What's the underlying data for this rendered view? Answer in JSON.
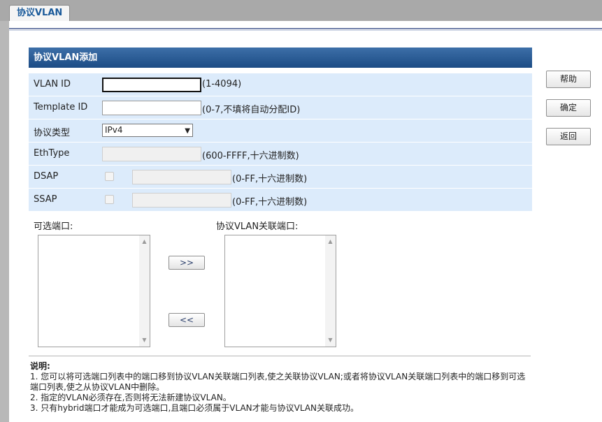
{
  "tab": {
    "label": "协议VLAN"
  },
  "panel": {
    "title": "协议VLAN添加"
  },
  "form": {
    "vlan_id": {
      "label": "VLAN ID",
      "value": "",
      "hint": "(1-4094)"
    },
    "template_id": {
      "label": "Template ID",
      "value": "",
      "hint": "(0-7,不填将自动分配ID)"
    },
    "protocol_type": {
      "label": "协议类型",
      "selected": "IPv4"
    },
    "ethtype": {
      "label": "EthType",
      "value": "",
      "hint": "(600-FFFF,十六进制数)"
    },
    "dsap": {
      "label": "DSAP",
      "checked": false,
      "value": "",
      "hint": "(0-FF,十六进制数)"
    },
    "ssap": {
      "label": "SSAP",
      "checked": false,
      "value": "",
      "hint": "(0-FF,十六进制数)"
    }
  },
  "buttons": {
    "help": "帮助",
    "confirm": "确定",
    "back": "返回"
  },
  "ports": {
    "available_label": "可选端口:",
    "associated_label": "协议VLAN关联端口:",
    "move_right": ">>",
    "move_left": "<<"
  },
  "notes": {
    "title": "说明:",
    "items": [
      "1. 您可以将可选端口列表中的端口移到协议VLAN关联端口列表,使之关联协议VLAN;或者将协议VLAN关联端口列表中的端口移到可选端口列表,使之从协议VLAN中删除。",
      "2. 指定的VLAN必须存在,否则将无法新建协议VLAN。",
      "3. 只有hybrid端口才能成为可选端口,且端口必须属于VLAN才能与协议VLAN关联成功。"
    ]
  },
  "colors": {
    "header": "#1c4c85",
    "row_bg": "#dcebfb",
    "tab_text": "#1a5a9a"
  }
}
